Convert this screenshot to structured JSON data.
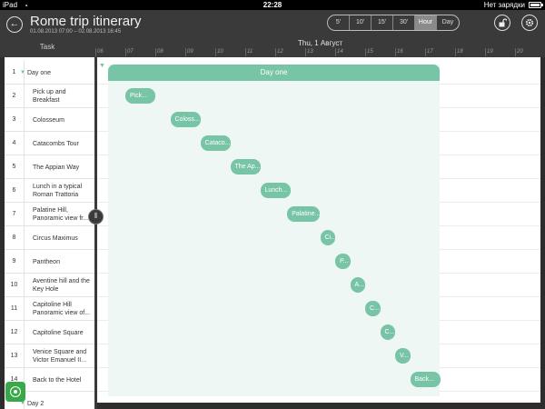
{
  "status_bar": {
    "device": "iPad",
    "time": "22:28",
    "charging": "Нет зарядки"
  },
  "header": {
    "title": "Rome trip itinerary",
    "subtitle": "01.08.2013 07:00 – 02.08.2013 16:45",
    "scale_options": [
      "5'",
      "10'",
      "15'",
      "30'",
      "Hour",
      "Day"
    ],
    "active_scale": "Hour"
  },
  "timeline": {
    "task_column_label": "Task",
    "date_label": "Thu, 1 Август",
    "hours": [
      "06",
      "07",
      "08",
      "09",
      "10",
      "11",
      "12",
      "13",
      "14",
      "15",
      "16",
      "17",
      "18",
      "19",
      "20"
    ]
  },
  "tasks": [
    {
      "num": "1",
      "name": "Day one",
      "group": true
    },
    {
      "num": "2",
      "name": "Pick up and Breakfast"
    },
    {
      "num": "3",
      "name": "Colosseum"
    },
    {
      "num": "4",
      "name": "Catacombs Tour"
    },
    {
      "num": "5",
      "name": "The Appian Way"
    },
    {
      "num": "6",
      "name": "Lunch in a typical Roman Trattoria"
    },
    {
      "num": "7",
      "name": "Palatine Hill, Panoramic view fr..."
    },
    {
      "num": "8",
      "name": "Circus Maximus"
    },
    {
      "num": "9",
      "name": "Pantheon"
    },
    {
      "num": "10",
      "name": "Aventine hill and the Key Hole"
    },
    {
      "num": "11",
      "name": "Capitoline Hill Panoramic view of..."
    },
    {
      "num": "12",
      "name": "Capitoline Square"
    },
    {
      "num": "13",
      "name": "Venice Square and Victor Emanuel II..."
    },
    {
      "num": "14",
      "name": "Back to the Hotel"
    },
    {
      "num": "",
      "name": "Day 2",
      "group": true
    }
  ],
  "gantt": {
    "group_label": "Day one",
    "bars": [
      {
        "label": "Pick...",
        "start": 7.0,
        "end": 8.0
      },
      {
        "label": "Coloss...",
        "start": 8.5,
        "end": 9.5
      },
      {
        "label": "Cataco...",
        "start": 9.5,
        "end": 10.5
      },
      {
        "label": "The Ap...",
        "start": 10.5,
        "end": 11.5
      },
      {
        "label": "Lunch...",
        "start": 11.5,
        "end": 12.5
      },
      {
        "label": "Palatine...",
        "start": 12.4,
        "end": 13.5
      },
      {
        "label": "Ci...",
        "start": 13.5,
        "end": 14.0
      },
      {
        "label": "P...",
        "start": 14.0,
        "end": 14.5
      },
      {
        "label": "A...",
        "start": 14.5,
        "end": 15.0
      },
      {
        "label": "C...",
        "start": 15.0,
        "end": 15.5
      },
      {
        "label": "C...",
        "start": 15.5,
        "end": 16.0
      },
      {
        "label": "V...",
        "start": 16.0,
        "end": 16.5
      },
      {
        "label": "Back...",
        "start": 16.5,
        "end": 17.5
      }
    ]
  },
  "colors": {
    "bar": "#78c4a6",
    "group_region": "#eef7f3",
    "fab": "#3aa84a"
  }
}
